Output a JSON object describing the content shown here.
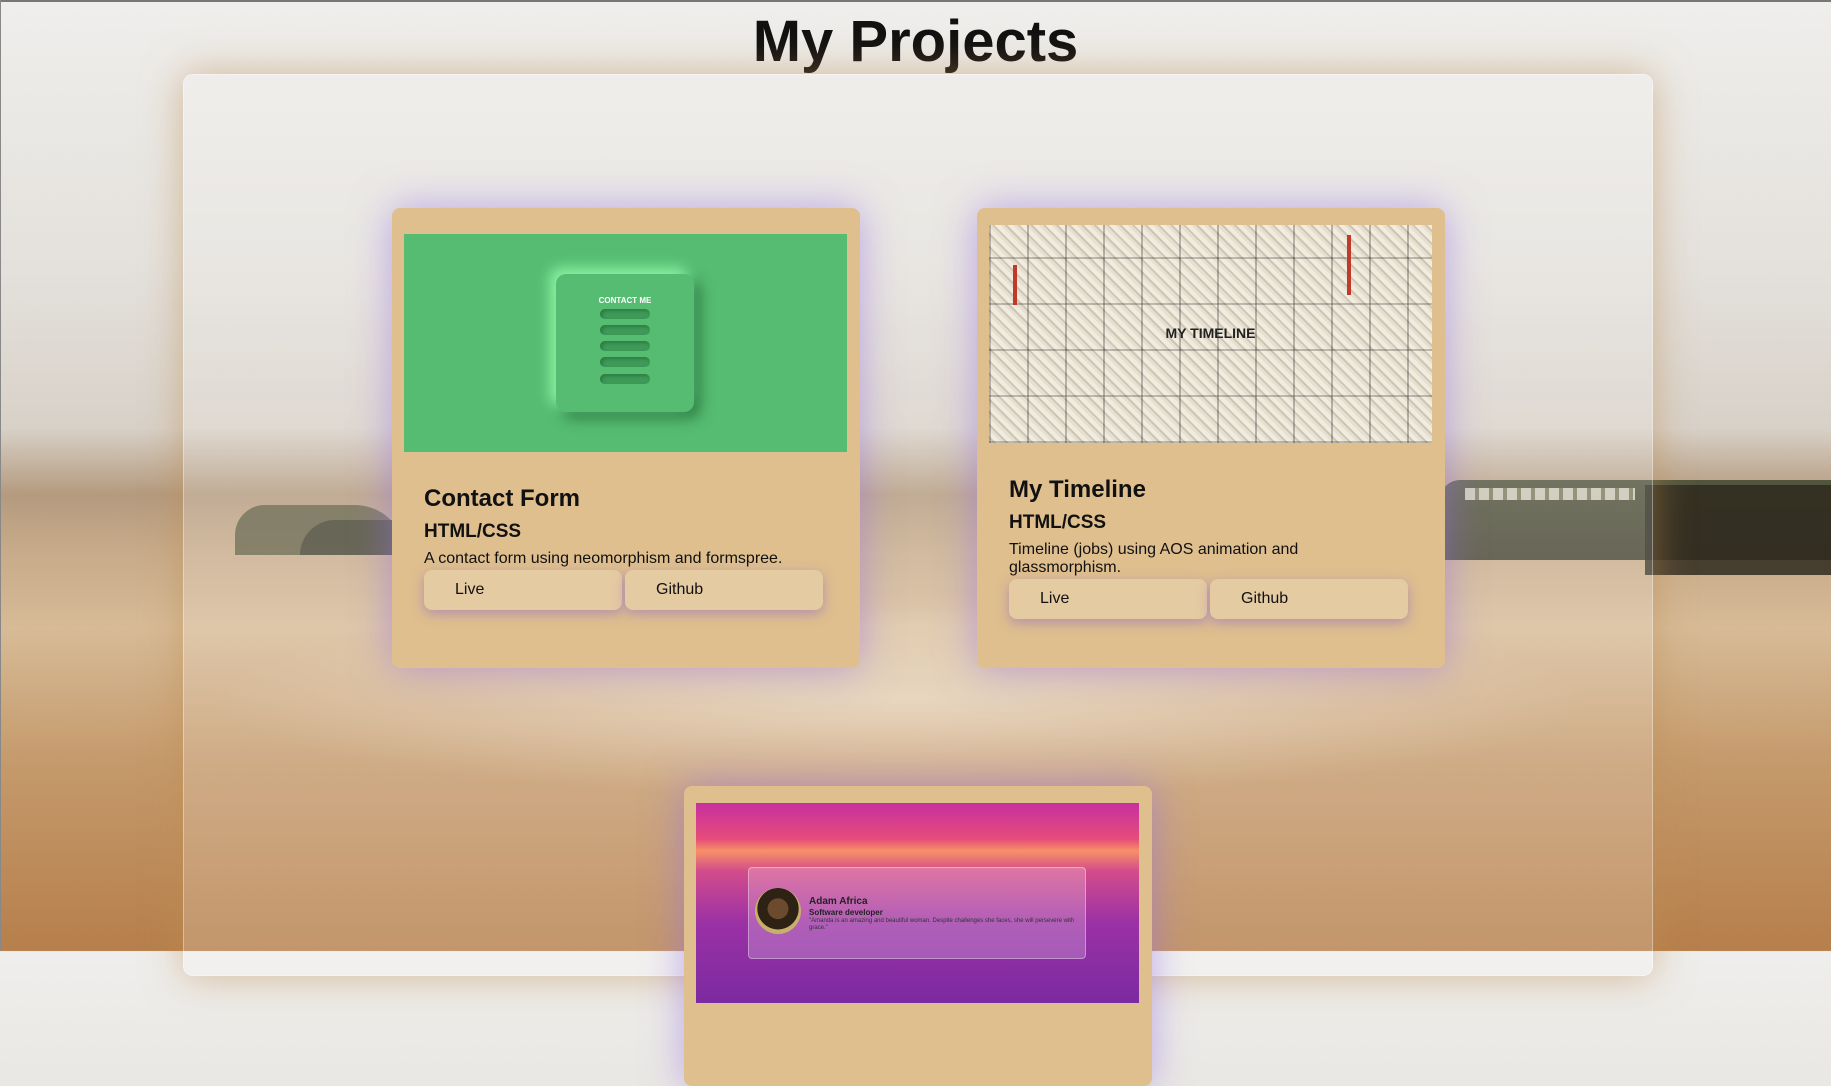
{
  "page": {
    "title": "My Projects"
  },
  "projects": [
    {
      "title": "Contact Form",
      "tech": "HTML/CSS",
      "description": "A contact form using neomorphism and formspree.",
      "live_label": "Live",
      "github_label": "Github",
      "thumbnail": {
        "heading": "CONTACT ME"
      }
    },
    {
      "title": "My Timeline",
      "tech": "HTML/CSS",
      "description": "Timeline (jobs) using AOS animation and glassmorphism.",
      "live_label": "Live",
      "github_label": "Github",
      "thumbnail": {
        "heading": "MY TIMELINE"
      }
    },
    {
      "thumbnail": {
        "name": "Adam Africa",
        "role": "Software developer",
        "quote": "\"Amanda is an amazing and beautiful woman. Despite challenges she faces, she will persevere with grace.\""
      }
    }
  ],
  "colors": {
    "card": "#dfbf8e",
    "button": "#e5cba2",
    "contact_bg": "#55bc71"
  }
}
